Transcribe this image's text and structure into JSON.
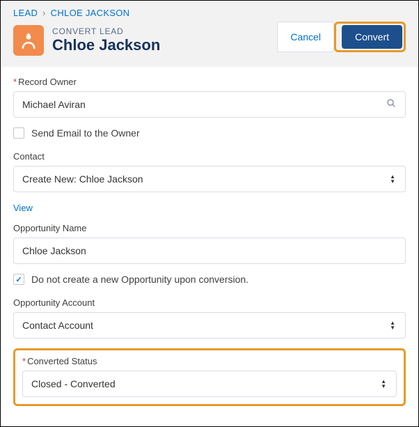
{
  "breadcrumb": {
    "root": "LEAD",
    "current": "CHLOE JACKSON"
  },
  "header": {
    "subtitle": "CONVERT LEAD",
    "title": "Chloe Jackson",
    "cancel": "Cancel",
    "convert": "Convert"
  },
  "fields": {
    "owner_label": "Record Owner",
    "owner_value": "Michael Aviran",
    "send_email_label": "Send Email to the Owner",
    "contact_label": "Contact",
    "contact_value": "Create New: Chloe Jackson",
    "view_link": "View",
    "opp_name_label": "Opportunity Name",
    "opp_name_value": "Chloe Jackson",
    "no_opp_label": "Do not create a new Opportunity upon conversion.",
    "opp_account_label": "Opportunity Account",
    "opp_account_value": "Contact Account",
    "conv_status_label": "Converted Status",
    "conv_status_value": "Closed - Converted"
  }
}
